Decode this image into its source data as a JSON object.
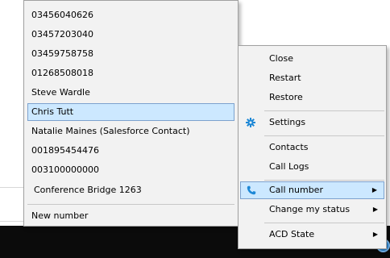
{
  "submenu": {
    "items": [
      {
        "label": "03456040626"
      },
      {
        "label": "03457203040"
      },
      {
        "label": "03459758758"
      },
      {
        "label": "01268508018"
      },
      {
        "label": "Steve Wardle"
      },
      {
        "label": "Chris Tutt"
      },
      {
        "label": "Natalie Maines (Salesforce Contact)"
      },
      {
        "label": "001895454476"
      },
      {
        "label": "003100000000"
      },
      {
        "label": "Conference Bridge 1263"
      }
    ],
    "selected": "Chris Tutt",
    "new_number": "New number"
  },
  "context_menu": {
    "close": "Close",
    "restart": "Restart",
    "restore": "Restore",
    "settings": "Settings",
    "contacts": "Contacts",
    "call_logs": "Call Logs",
    "call_number": "Call number",
    "change_status": "Change my status",
    "acd_state": "ACD State"
  },
  "colors": {
    "highlight": "#cce8ff",
    "highlight_border": "#7da2ce",
    "menu_bg": "#f2f2f2",
    "icon_blue": "#1e88d6",
    "taskbar": "#0b0b0b"
  },
  "icons": {
    "settings": "gear-icon",
    "call_number": "phone-icon",
    "submenu_arrow": "chevron-right-icon"
  }
}
